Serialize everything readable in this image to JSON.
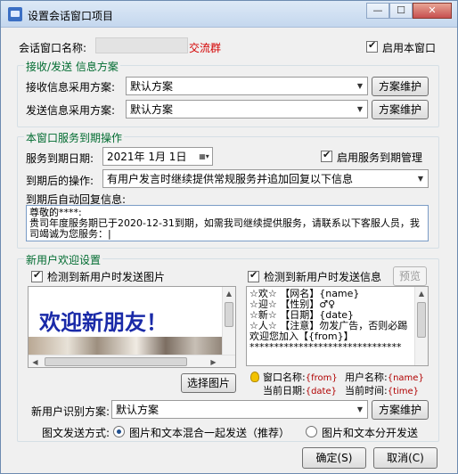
{
  "window": {
    "title": "设置会话窗口项目",
    "min_glyph": "—",
    "max_glyph": "☐",
    "close_glyph": "✕"
  },
  "session": {
    "name_label": "会话窗口名称:",
    "name_suffix": "交流群",
    "enable_label": "启用本窗口",
    "enable_checked": true
  },
  "info_scheme": {
    "group_title": "接收/发送 信息方案",
    "receive_label": "接收信息采用方案:",
    "receive_value": "默认方案",
    "send_label": "发送信息采用方案:",
    "send_value": "默认方案",
    "maintain_label": "方案维护"
  },
  "expiry": {
    "group_title": "本窗口服务到期操作",
    "date_label": "服务到期日期:",
    "date_value": "2021年 1月 1日",
    "enable_label": "启用服务到期管理",
    "enable_checked": true,
    "action_label": "到期后的操作:",
    "action_value": "有用户发言时继续提供常规服务并追加回复以下信息",
    "reply_label": "到期后自动回复信息:",
    "reply_text": "尊敬的****:\n贵司年度服务期已于2020-12-31到期，如需我司继续提供服务，请联系以下客服人员，我司竭诚为您服务：|"
  },
  "welcome": {
    "group_title": "新用户欢迎设置",
    "send_image_label": "检测到新用户时发送图片",
    "send_image_checked": true,
    "image_text": "欢迎新朋友！",
    "select_image_label": "选择图片",
    "send_info_label": "检测到新用户时发送信息",
    "send_info_checked": true,
    "preview_label": "预览",
    "message_text": "☆欢☆ 【网名】{name}\n☆迎☆ 【性别】♂♀\n☆新☆ 【日期】{date}\n☆人☆ 【注意】勿发广告，否则必踢\n欢迎您加入【{from}】\n*******************************",
    "help": {
      "window_name_label": "窗口名称:",
      "window_name_tag": "{from}",
      "user_name_label": "用户名称:",
      "user_name_tag": "{name}",
      "current_date_label": "当前日期:",
      "current_date_tag": "{date}",
      "current_time_label": "当前时间:",
      "current_time_tag": "{time}"
    },
    "identify_label": "新用户识别方案:",
    "identify_value": "默认方案",
    "identify_maintain_label": "方案维护",
    "mode_label": "图文发送方式:",
    "mode_mixed_label": "图片和文本混合一起发送（推荐）",
    "mode_separate_label": "图片和文本分开发送",
    "mode_selected": "mixed"
  },
  "footer": {
    "ok_label": "确定(S)",
    "cancel_label": "取消(C)"
  },
  "icons": {
    "app": "app-window-icon",
    "calendar": "calendar-icon",
    "bulb": "lightbulb-icon"
  },
  "colors": {
    "group_title": "#006b30",
    "accent_red": "#d40000",
    "welcome_blue": "#1a2aa8"
  }
}
